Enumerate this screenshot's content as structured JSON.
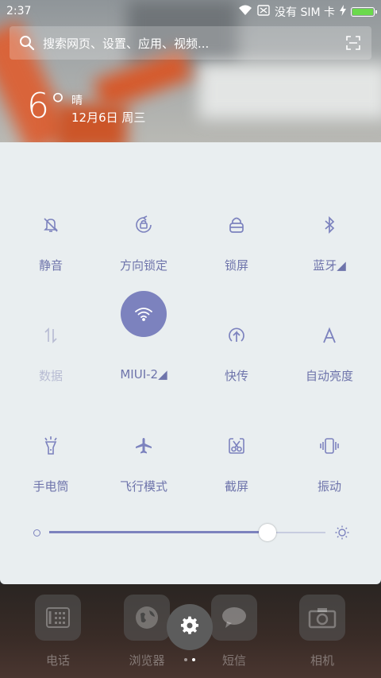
{
  "status_bar": {
    "time": "2:37",
    "carrier": "没有 SIM 卡",
    "battery_level": 1.0
  },
  "search": {
    "placeholder": "搜索网页、设置、应用、视频..."
  },
  "weather": {
    "temperature": "6°",
    "condition": "晴",
    "date": "12月6日 周三"
  },
  "toggles": [
    {
      "label": "静音",
      "icon": "mute-bell-icon",
      "active": false
    },
    {
      "label": "方向锁定",
      "icon": "rotation-lock-icon",
      "active": false
    },
    {
      "label": "锁屏",
      "icon": "lock-icon",
      "active": false
    },
    {
      "label": "蓝牙◢",
      "icon": "bluetooth-icon",
      "active": false
    },
    {
      "label": "数据",
      "icon": "data-arrows-icon",
      "active": false
    },
    {
      "label": "MIUI-2◢",
      "icon": "wifi-icon",
      "active": true
    },
    {
      "label": "快传",
      "icon": "transfer-icon",
      "active": false
    },
    {
      "label": "自动亮度",
      "icon": "auto-brightness-icon",
      "active": false
    },
    {
      "label": "手电筒",
      "icon": "flashlight-icon",
      "active": false
    },
    {
      "label": "飞行模式",
      "icon": "airplane-icon",
      "active": false
    },
    {
      "label": "截屏",
      "icon": "screenshot-icon",
      "active": false
    },
    {
      "label": "振动",
      "icon": "vibrate-icon",
      "active": false
    }
  ],
  "brightness": {
    "level": 0.79
  },
  "dock": [
    {
      "label": "电话",
      "icon": "phone-icon"
    },
    {
      "label": "浏览器",
      "icon": "browser-icon"
    },
    {
      "label": "短信",
      "icon": "message-icon"
    },
    {
      "label": "相机",
      "icon": "camera-icon"
    }
  ],
  "colors": {
    "accent": "#7c82be",
    "panel_bg": "#e9eef0",
    "label": "#6e74ab",
    "battery": "#6bd94c"
  }
}
